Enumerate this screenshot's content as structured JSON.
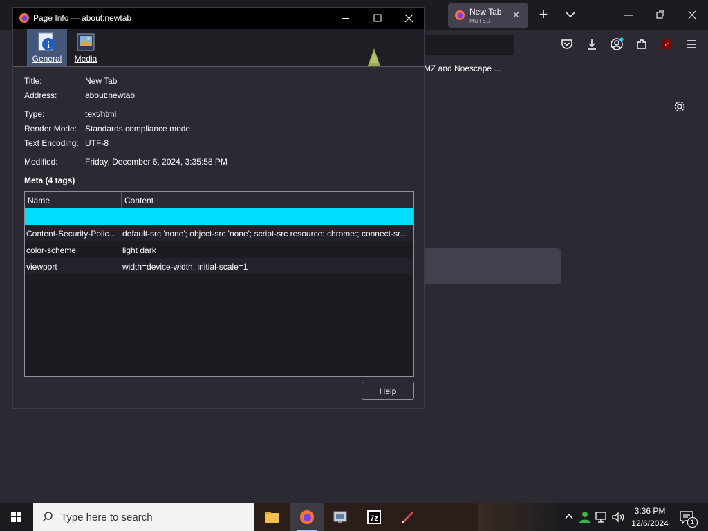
{
  "browser": {
    "tab": {
      "title": "New Tab",
      "subtitle": "MUTED",
      "close_icon": "✕"
    },
    "new_tab_icon": "+",
    "list_tabs_icon": "⌄",
    "bookmark_text": "MZ and Noescape ..."
  },
  "dialog": {
    "title": "Page Info — about:newtab",
    "tabs": [
      {
        "label": "General",
        "active": true
      },
      {
        "label": "Media",
        "active": false
      }
    ],
    "fields": {
      "title_label": "Title:",
      "title_value": "New Tab",
      "address_label": "Address:",
      "address_value": "about:newtab",
      "type_label": "Type:",
      "type_value": "text/html",
      "render_label": "Render Mode:",
      "render_value": "Standards compliance mode",
      "encoding_label": "Text Encoding:",
      "encoding_value": "UTF-8",
      "modified_label": "Modified:",
      "modified_value": "Friday, December 6, 2024, 3:35:58 PM"
    },
    "meta_heading": "Meta (4 tags)",
    "meta_columns": {
      "name": "Name",
      "content": "Content"
    },
    "meta_rows": [
      {
        "name": "",
        "content": ""
      },
      {
        "name": "Content-Security-Polic...",
        "content": "default-src 'none'; object-src 'none'; script-src resource: chrome:; connect-sr..."
      },
      {
        "name": "color-scheme",
        "content": "light dark"
      },
      {
        "name": "viewport",
        "content": "width=device-width, initial-scale=1"
      }
    ],
    "help_label": "Help"
  },
  "taskbar": {
    "search_placeholder": "Type here to search",
    "time": "3:36 PM",
    "date": "12/6/2024",
    "notification_count": "1"
  },
  "colors": {
    "selection": "#00ddff",
    "dialog_bg": "#2b2a33",
    "accent_tab": "#44577a"
  }
}
